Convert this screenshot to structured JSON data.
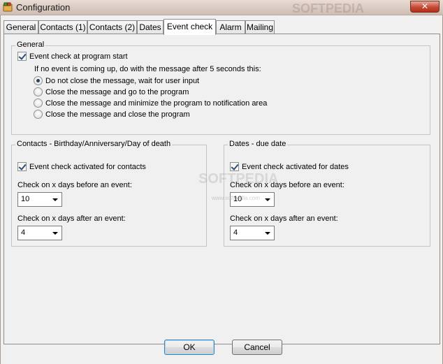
{
  "window": {
    "title": "Configuration",
    "close_glyph": "✕",
    "icon": "app-icon"
  },
  "tabs": [
    {
      "label": "General"
    },
    {
      "label": "Contacts (1)"
    },
    {
      "label": "Contacts (2)"
    },
    {
      "label": "Dates"
    },
    {
      "label": "Event check",
      "active": true
    },
    {
      "label": "Alarm"
    },
    {
      "label": "Mailing"
    }
  ],
  "general": {
    "legend": "General",
    "event_check_label": "Event check at program start",
    "event_check_checked": true,
    "instruction": "If no event is coming up, do with the message after 5 seconds this:",
    "options": [
      {
        "label": "Do not close the message, wait for user input",
        "checked": true
      },
      {
        "label": "Close the message and go to the program",
        "checked": false
      },
      {
        "label": "Close the message and minimize the program to notification area",
        "checked": false
      },
      {
        "label": "Close the message and close the program",
        "checked": false
      }
    ]
  },
  "contacts": {
    "legend": "Contacts - Birthday/Anniversary/Day of death",
    "activated_label": "Event check activated for contacts",
    "activated_checked": true,
    "before_label": "Check on x days before an event:",
    "before_value": "10",
    "after_label": "Check on x days after an event:",
    "after_value": "4"
  },
  "dates": {
    "legend": "Dates - due date",
    "activated_label": "Event check activated for dates",
    "activated_checked": true,
    "before_label": "Check on x days before an event:",
    "before_value": "10",
    "after_label": "Check on x days after an event:",
    "after_value": "4"
  },
  "buttons": {
    "ok": "OK",
    "cancel": "Cancel"
  },
  "watermark": {
    "top": "SOFTPEDIA",
    "center": "SOFTPEDIA",
    "small": "www.softpedia.com"
  },
  "colors": {
    "accent": "#3c7fb1",
    "close": "#c64a36"
  }
}
